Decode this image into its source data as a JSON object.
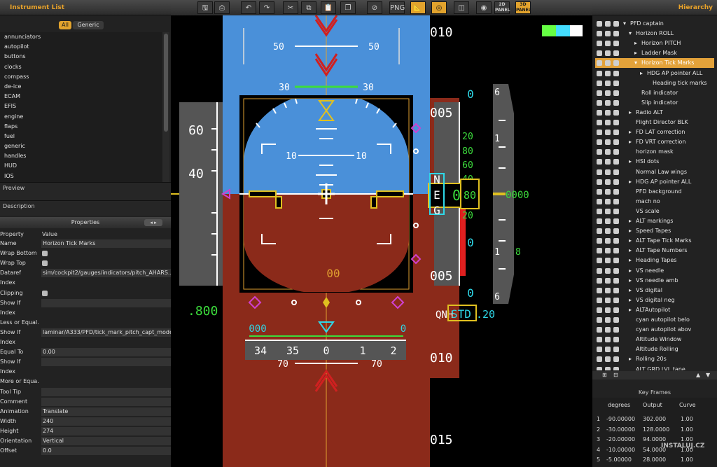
{
  "left_panel": {
    "title": "Instrument List",
    "filter_all": "All",
    "filter_generic": "Generic",
    "items": [
      "annunciators",
      "autopilot",
      "buttons",
      "clocks",
      "compass",
      "de-ice",
      "ECAM",
      "EFIS",
      "engine",
      "flaps",
      "fuel",
      "generic",
      "handles",
      "HUD",
      "IOS"
    ],
    "preview_label": "Preview",
    "description_label": "Description",
    "properties_title": "Properties",
    "prop_header_key": "Property",
    "prop_header_value": "Value",
    "properties": [
      {
        "k": "Name",
        "v": "Horizon Tick Marks",
        "type": "text"
      },
      {
        "k": "Wrap Bottom",
        "v": "",
        "type": "check"
      },
      {
        "k": "Wrap Top",
        "v": "",
        "type": "check"
      },
      {
        "k": "Dataref",
        "v": "sim/cockpit2/gauges/indicators/pitch_AHARS...",
        "type": "text"
      },
      {
        "k": "Index",
        "v": "",
        "type": "none"
      },
      {
        "k": "Clipping",
        "v": "",
        "type": "check"
      },
      {
        "k": "Show If",
        "v": "",
        "type": "text"
      },
      {
        "k": "Index",
        "v": "",
        "type": "none"
      },
      {
        "k": "Less or Equal...",
        "v": "",
        "type": "none"
      },
      {
        "k": "Show If",
        "v": "laminar/A333/PFD/tick_mark_pitch_capt_mode",
        "type": "text"
      },
      {
        "k": "Index",
        "v": "",
        "type": "none"
      },
      {
        "k": "Equal To",
        "v": "0.00",
        "type": "text"
      },
      {
        "k": "Show If",
        "v": "",
        "type": "text"
      },
      {
        "k": "Index",
        "v": "",
        "type": "none"
      },
      {
        "k": "More or Equa...",
        "v": "",
        "type": "none"
      },
      {
        "k": "Tool Tip",
        "v": "",
        "type": "text"
      },
      {
        "k": "Comment",
        "v": "",
        "type": "text"
      },
      {
        "k": "Animation",
        "v": "Translate",
        "type": "text"
      },
      {
        "k": "Width",
        "v": "240",
        "type": "text"
      },
      {
        "k": "Height",
        "v": "274",
        "type": "text"
      },
      {
        "k": "Orientation",
        "v": "Vertical",
        "type": "text"
      },
      {
        "k": "Offset",
        "v": "0.0",
        "type": "text"
      }
    ]
  },
  "toolbar": {
    "buttons": [
      {
        "name": "save-button",
        "glyph": "🖫"
      },
      {
        "name": "print-button",
        "glyph": "⎙"
      },
      {
        "name": "undo-button",
        "glyph": "↶"
      },
      {
        "name": "redo-button",
        "glyph": "↷"
      },
      {
        "name": "cut-button",
        "glyph": "✂"
      },
      {
        "name": "copy-button",
        "glyph": "⧉"
      },
      {
        "name": "paste-button",
        "glyph": "📋"
      },
      {
        "name": "duplicate-button",
        "glyph": "❐"
      },
      {
        "name": "no-button",
        "glyph": "⊘"
      },
      {
        "name": "png-button",
        "glyph": "PNG"
      },
      {
        "name": "ruler-button",
        "glyph": "📐",
        "on": true
      },
      {
        "name": "target-button",
        "glyph": "◎",
        "on": true
      },
      {
        "name": "split-button",
        "glyph": "◫"
      },
      {
        "name": "globe-button",
        "glyph": "◉"
      },
      {
        "name": "panel-2d-button",
        "glyph": "2D PANEL"
      },
      {
        "name": "panel-3d-button",
        "glyph": "3D PANEL",
        "on": true
      }
    ]
  },
  "right_panel": {
    "title": "Hierarchy",
    "items": [
      {
        "label": "PFD captain",
        "indent": 0,
        "arrow": "▾"
      },
      {
        "label": "Horizon ROLL",
        "indent": 1,
        "arrow": "▾"
      },
      {
        "label": "Horizon PITCH",
        "indent": 2,
        "arrow": "▸"
      },
      {
        "label": "Ladder Mask",
        "indent": 2,
        "arrow": "▸"
      },
      {
        "label": "Horizon Tick Marks",
        "indent": 2,
        "arrow": "▾",
        "sel": true
      },
      {
        "label": "HDG AP pointer ALL",
        "indent": 3,
        "arrow": "▸"
      },
      {
        "label": "Heading tick marks",
        "indent": 4,
        "arrow": ""
      },
      {
        "label": "Roll indicator",
        "indent": 2,
        "arrow": ""
      },
      {
        "label": "Slip indicator",
        "indent": 2,
        "arrow": ""
      },
      {
        "label": "Radio ALT",
        "indent": 1,
        "arrow": "▸"
      },
      {
        "label": "Flight Director BLK",
        "indent": 1,
        "arrow": ""
      },
      {
        "label": "FD LAT correction",
        "indent": 1,
        "arrow": "▸"
      },
      {
        "label": "FD VRT correction",
        "indent": 1,
        "arrow": "▸"
      },
      {
        "label": "horizon mask",
        "indent": 1,
        "arrow": ""
      },
      {
        "label": "HSI dots",
        "indent": 1,
        "arrow": "▸"
      },
      {
        "label": "Normal Law wings",
        "indent": 1,
        "arrow": ""
      },
      {
        "label": "HDG AP pointer ALL",
        "indent": 1,
        "arrow": "▸"
      },
      {
        "label": "PFD background",
        "indent": 1,
        "arrow": ""
      },
      {
        "label": "mach no",
        "indent": 1,
        "arrow": ""
      },
      {
        "label": "VS scale",
        "indent": 1,
        "arrow": ""
      },
      {
        "label": "ALT markings",
        "indent": 1,
        "arrow": "▸"
      },
      {
        "label": "Speed Tapes",
        "indent": 1,
        "arrow": "▸"
      },
      {
        "label": "ALT Tape Tick Marks",
        "indent": 1,
        "arrow": "▸"
      },
      {
        "label": "ALT Tape Numbers",
        "indent": 1,
        "arrow": "▸"
      },
      {
        "label": "Heading Tapes",
        "indent": 1,
        "arrow": "▸"
      },
      {
        "label": "VS needle",
        "indent": 1,
        "arrow": "▸"
      },
      {
        "label": "VS needle amb",
        "indent": 1,
        "arrow": "▸"
      },
      {
        "label": "VS digital",
        "indent": 1,
        "arrow": "▸"
      },
      {
        "label": "VS digital neg",
        "indent": 1,
        "arrow": "▸"
      },
      {
        "label": "ALTAutopilot",
        "indent": 1,
        "arrow": "▸"
      },
      {
        "label": "cyan autopilot belo",
        "indent": 1,
        "arrow": ""
      },
      {
        "label": "cyan autopilot abov",
        "indent": 1,
        "arrow": ""
      },
      {
        "label": "Altitude Window",
        "indent": 1,
        "arrow": ""
      },
      {
        "label": "Altitude Rolling",
        "indent": 1,
        "arrow": ""
      },
      {
        "label": "Rolling 20s",
        "indent": 1,
        "arrow": "▸"
      },
      {
        "label": "ALT GRD LVL tape",
        "indent": 1,
        "arrow": ""
      }
    ],
    "keyframes_title": "Key Frames",
    "kf_headers": [
      "degrees",
      "Output",
      "Curve"
    ],
    "keyframes": [
      {
        "n": "1",
        "deg": "-90.00000",
        "out": "302.000",
        "curve": "1.00"
      },
      {
        "n": "2",
        "deg": "-30.00000",
        "out": "128.0000",
        "curve": "1.00"
      },
      {
        "n": "3",
        "deg": "-20.00000",
        "out": "94.0000",
        "curve": "1.00"
      },
      {
        "n": "4",
        "deg": "-10.00000",
        "out": "54.0000",
        "curve": "1.00"
      },
      {
        "n": "5",
        "deg": "-5.00000",
        "out": "28.0000",
        "curve": "1.00"
      }
    ],
    "watermark": "INSTALUJ.CZ"
  },
  "pfd": {
    "colors": {
      "sky": "#4a90d9",
      "ground": "#8b2a1a",
      "green": "#3cdc3c",
      "cyan": "#2ed8e8",
      "magenta": "#d040d0",
      "yellow": "#e0c020",
      "amber": "#e0a030"
    },
    "pitch_labels": [
      "50",
      "50",
      "30",
      "30",
      "10",
      "10",
      "10",
      "10",
      "70",
      "70"
    ],
    "speed_labels": [
      "60",
      "40"
    ],
    "mach": ".800",
    "alt_labels": [
      "010",
      "005",
      "005",
      "010",
      "015"
    ],
    "alt_green_ticks": [
      "20",
      "80",
      "60",
      "40",
      "20"
    ],
    "alt_current": "80",
    "alt_cyan_top": "0",
    "alt_cyan_mid": "0",
    "alt_cyan_bot": "0",
    "alt_window_value": "0",
    "fma": [
      "N",
      "E",
      "G"
    ],
    "vs_labels": [
      "6",
      "1",
      "1",
      "6",
      "8"
    ],
    "vs_value": "0000",
    "qnh_label": "QNH",
    "std_label": "STD",
    "baro_value": ".20",
    "heading_labels": [
      "34",
      "35",
      "0",
      "1",
      "2"
    ],
    "heading_readout": "000",
    "heading_cyan_right": "0",
    "center_marker": "00"
  }
}
